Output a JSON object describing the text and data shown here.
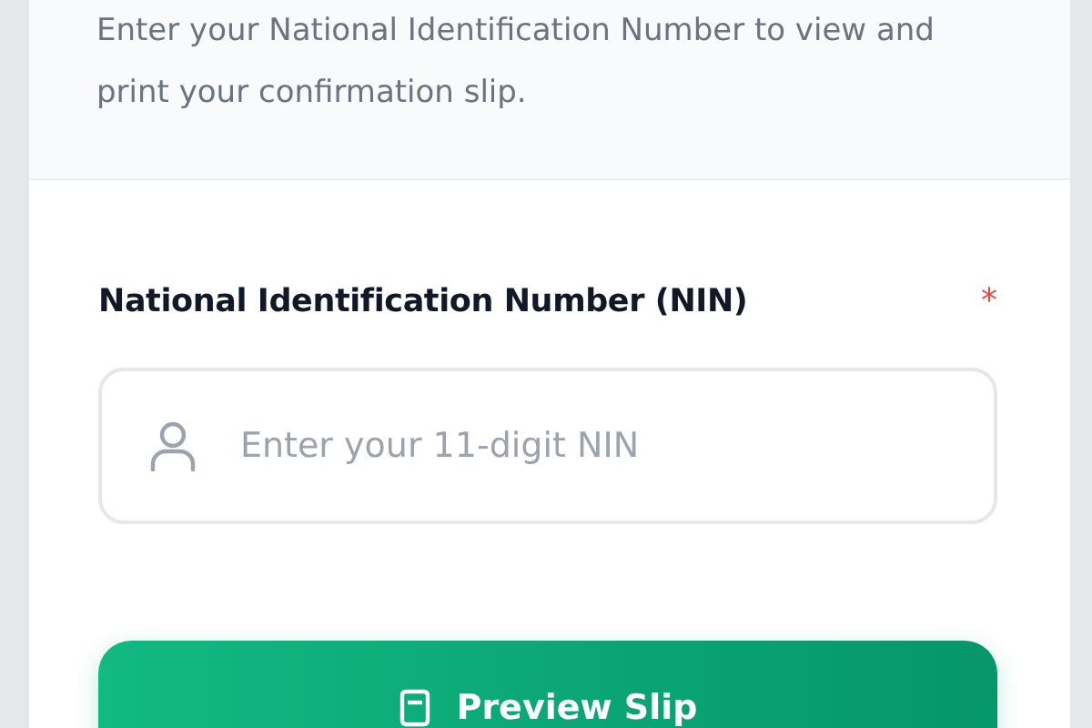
{
  "intro": {
    "text": "Enter your National Identification Number to view and print your confirmation slip."
  },
  "field": {
    "label": "National Identification Number (NIN)",
    "required": true,
    "required_mark": "*",
    "placeholder": "Enter your 11-digit NIN"
  },
  "button": {
    "label": "Preview Slip"
  }
}
